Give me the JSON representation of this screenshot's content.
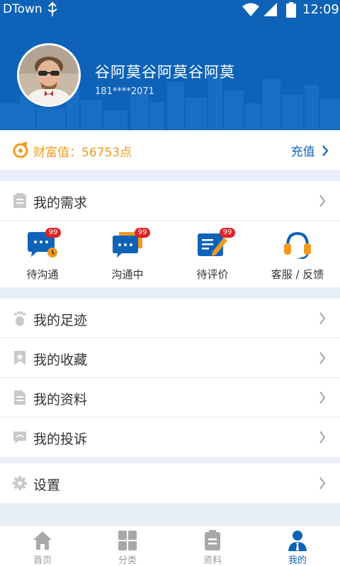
{
  "status_bar": {
    "carrier": "DTown",
    "time": "12:09"
  },
  "profile": {
    "name": "谷阿莫谷阿莫谷阿莫",
    "phone": "181****2071"
  },
  "wealth": {
    "text": "财富值：56753点",
    "recharge_label": "充值"
  },
  "needs": {
    "title": "我的需求",
    "items": [
      {
        "label": "待沟通",
        "badge": "99",
        "icon": "chat-clock-icon"
      },
      {
        "label": "沟通中",
        "badge": "99",
        "icon": "chat-bubbles-icon"
      },
      {
        "label": "待评价",
        "badge": "99",
        "icon": "review-pencil-icon"
      },
      {
        "label": "客服 / 反馈",
        "badge": "",
        "icon": "headset-icon"
      }
    ]
  },
  "menu": [
    {
      "label": "我的足迹",
      "icon": "footprint-icon"
    },
    {
      "label": "我的收藏",
      "icon": "bookmark-icon"
    },
    {
      "label": "我的资料",
      "icon": "document-icon"
    },
    {
      "label": "我的投诉",
      "icon": "complaint-icon"
    }
  ],
  "settings": {
    "label": "设置"
  },
  "bottom_nav": [
    {
      "label": "首页",
      "icon": "home-icon",
      "active": false
    },
    {
      "label": "分类",
      "icon": "grid-icon",
      "active": false
    },
    {
      "label": "资料",
      "icon": "clipboard-icon",
      "active": false
    },
    {
      "label": "我的",
      "icon": "person-icon",
      "active": true
    }
  ],
  "colors": {
    "primary": "#0e63b8",
    "accent": "#f39a1f",
    "badge": "#e02323",
    "background": "#e9eff8"
  }
}
